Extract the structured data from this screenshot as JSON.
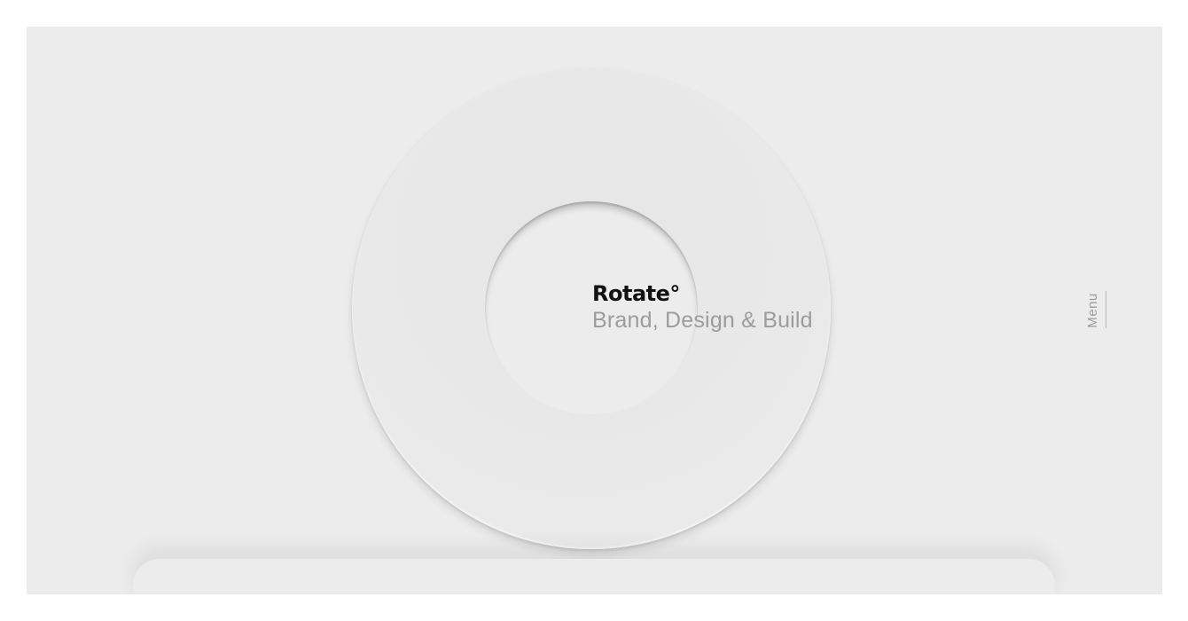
{
  "brand": {
    "name": "Rotate°",
    "tagline": "Brand, Design & Build"
  },
  "nav": {
    "menu_label": "Menu"
  },
  "colors": {
    "background": "#ececec",
    "brand_text": "#111111",
    "muted_text": "#9c9c9c"
  },
  "icons": {
    "hero_ring": "ring-icon"
  }
}
